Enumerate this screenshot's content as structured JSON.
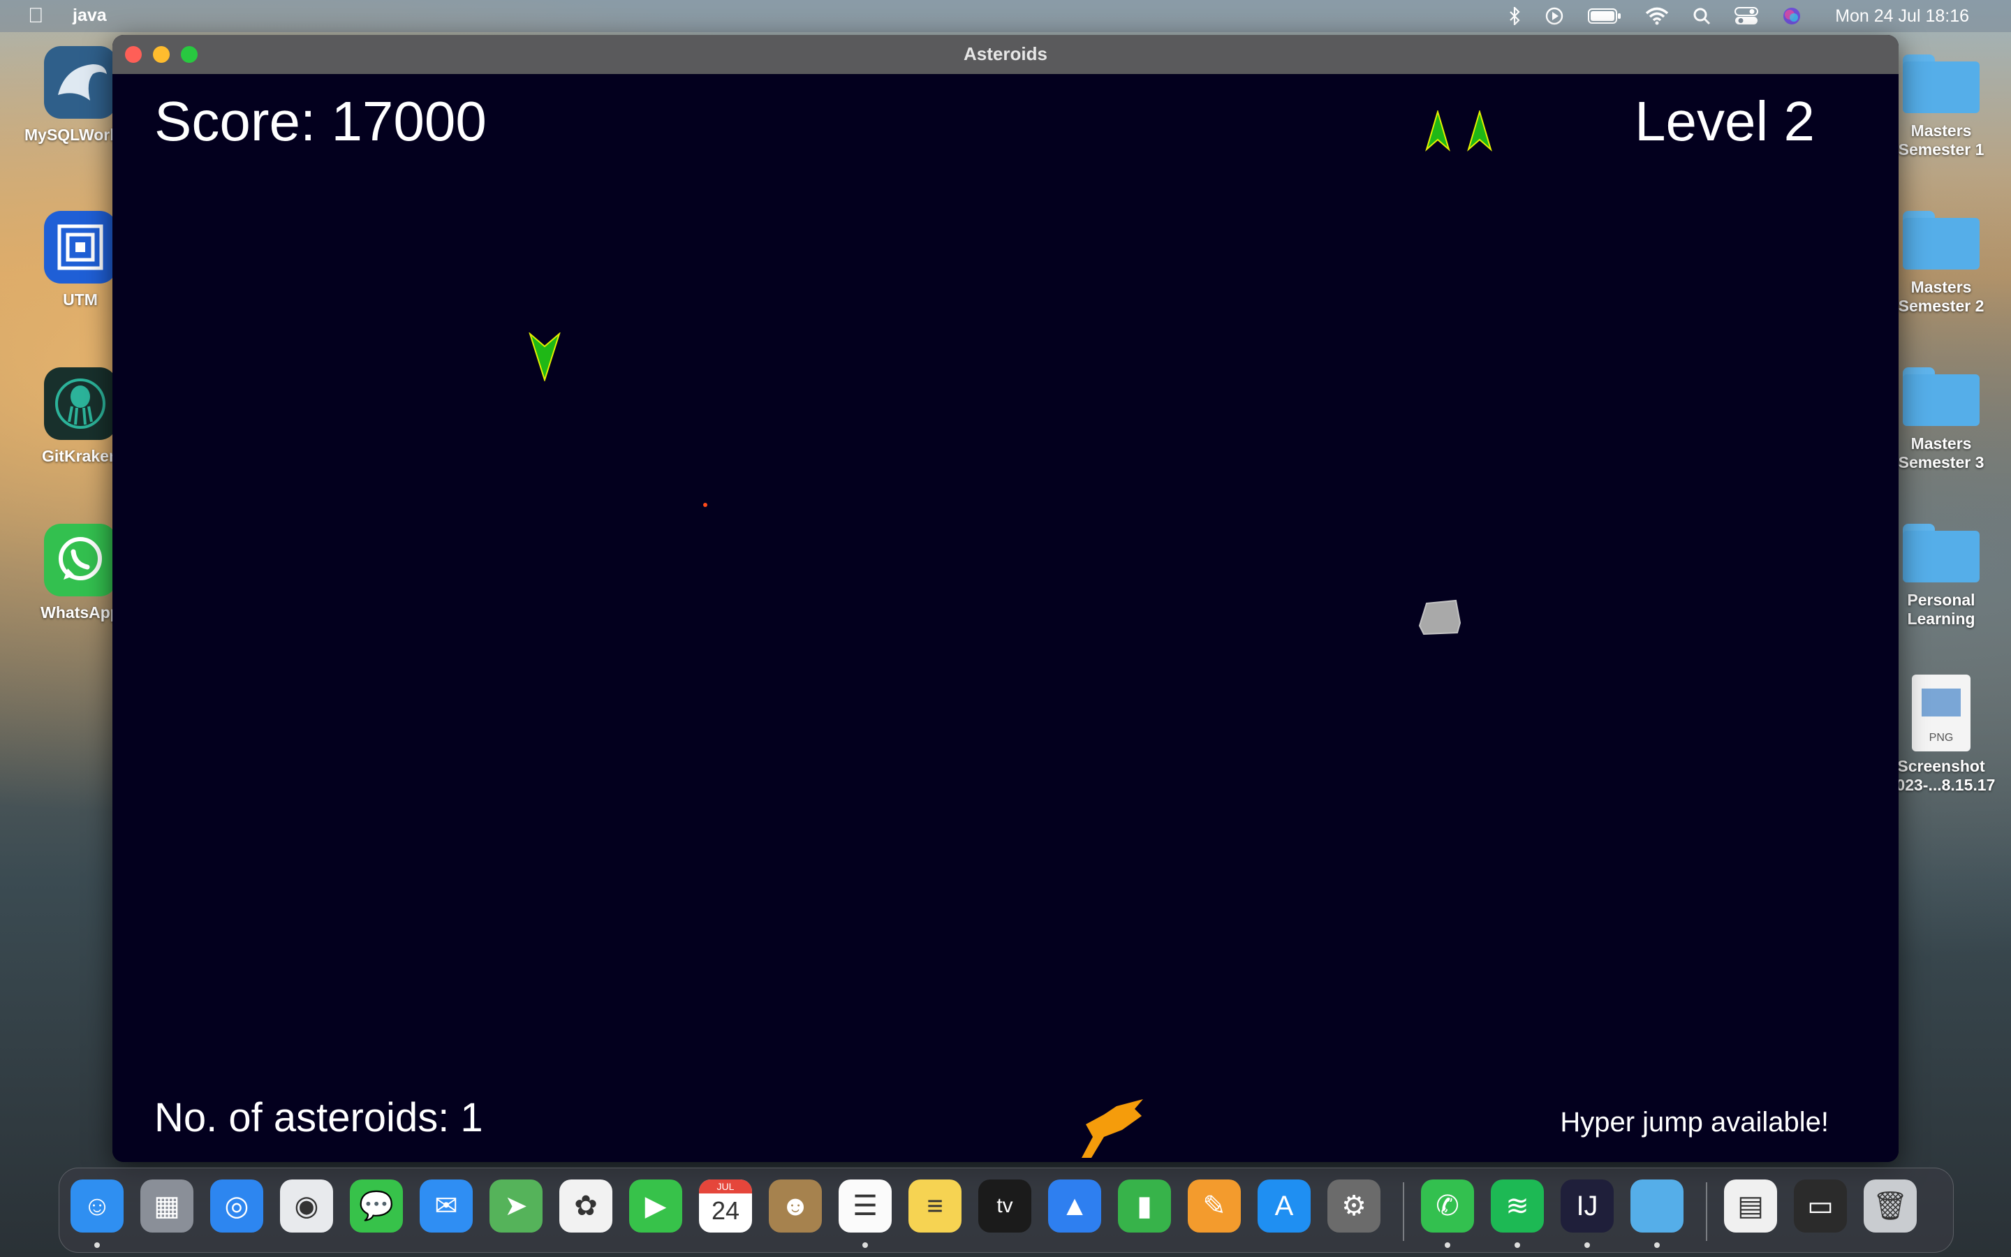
{
  "menubar": {
    "app_name": "java",
    "clock": "Mon 24 Jul  18:16"
  },
  "desktop": {
    "left_icons": [
      {
        "label": "MySQLWorkbench",
        "color": "#2f5f8a"
      },
      {
        "label": "UTM",
        "color": "#1f5fd6"
      },
      {
        "label": "GitKraken",
        "color": "#18302c"
      },
      {
        "label": "WhatsApp",
        "color": "#33c04f"
      }
    ],
    "right_icons": [
      {
        "label": "Masters Semester 1"
      },
      {
        "label": "Masters Semester 2"
      },
      {
        "label": "Masters Semester 3"
      },
      {
        "label": "Personal Learning"
      },
      {
        "label": "Screenshot 2023-...8.15.17",
        "badge": "PNG"
      }
    ]
  },
  "window": {
    "title": "Asteroids",
    "game": {
      "score_text": "Score: 17000",
      "level_text": "Level 2",
      "asteroids_text": "No. of asteroids: 1",
      "hyperjump_text": "Hyper jump available!",
      "lives": 2,
      "background": "#03001e",
      "ship_color": "#1fb816",
      "asteroid_color": "#a9a9a9",
      "ufo_color": "#f59c0b",
      "bullet_color": "#ff4a1a"
    }
  },
  "dock": {
    "apps": [
      {
        "name": "finder",
        "color": "#2f8ff1",
        "glyph": "☺"
      },
      {
        "name": "launchpad",
        "color": "#8a8f98",
        "glyph": "▦"
      },
      {
        "name": "safari",
        "color": "#2d86f0",
        "glyph": "◎"
      },
      {
        "name": "chrome",
        "color": "#e8eaed",
        "glyph": "◉"
      },
      {
        "name": "messages",
        "color": "#37c24a",
        "glyph": "💬"
      },
      {
        "name": "mail",
        "color": "#2f8ef3",
        "glyph": "✉"
      },
      {
        "name": "maps",
        "color": "#55b35a",
        "glyph": "➤"
      },
      {
        "name": "photos",
        "color": "#f2f2f2",
        "glyph": "✿"
      },
      {
        "name": "facetime",
        "color": "#37c24a",
        "glyph": "▶"
      },
      {
        "name": "calendar",
        "color": "#ffffff",
        "glyph": "24",
        "badge": "JUL"
      },
      {
        "name": "contacts",
        "color": "#a6824e",
        "glyph": "☻"
      },
      {
        "name": "reminders",
        "color": "#fbfbfb",
        "glyph": "☰"
      },
      {
        "name": "notes",
        "color": "#f6d352",
        "glyph": "≡"
      },
      {
        "name": "apple-tv",
        "color": "#1b1b1b",
        "glyph": "tv"
      },
      {
        "name": "keynote",
        "color": "#2e7ff0",
        "glyph": "▲"
      },
      {
        "name": "numbers",
        "color": "#37b34a",
        "glyph": "▮"
      },
      {
        "name": "pages",
        "color": "#f39b2d",
        "glyph": "✎"
      },
      {
        "name": "app-store",
        "color": "#1f8ff2",
        "glyph": "A"
      },
      {
        "name": "system-settings",
        "color": "#6b6b6b",
        "glyph": "⚙"
      },
      {
        "name": "whatsapp",
        "color": "#33c04f",
        "glyph": "✆"
      },
      {
        "name": "spotify",
        "color": "#1db954",
        "glyph": "≋"
      },
      {
        "name": "intellij",
        "color": "#1f1f3a",
        "glyph": "IJ"
      },
      {
        "name": "folder",
        "color": "#55aee9",
        "glyph": ""
      },
      {
        "name": "preview-document",
        "color": "#f0f0f0",
        "glyph": "▤"
      },
      {
        "name": "screen-recording",
        "color": "#2b2b2b",
        "glyph": "▭"
      },
      {
        "name": "trash",
        "color": "#c9ccd0",
        "glyph": "🗑"
      }
    ]
  }
}
